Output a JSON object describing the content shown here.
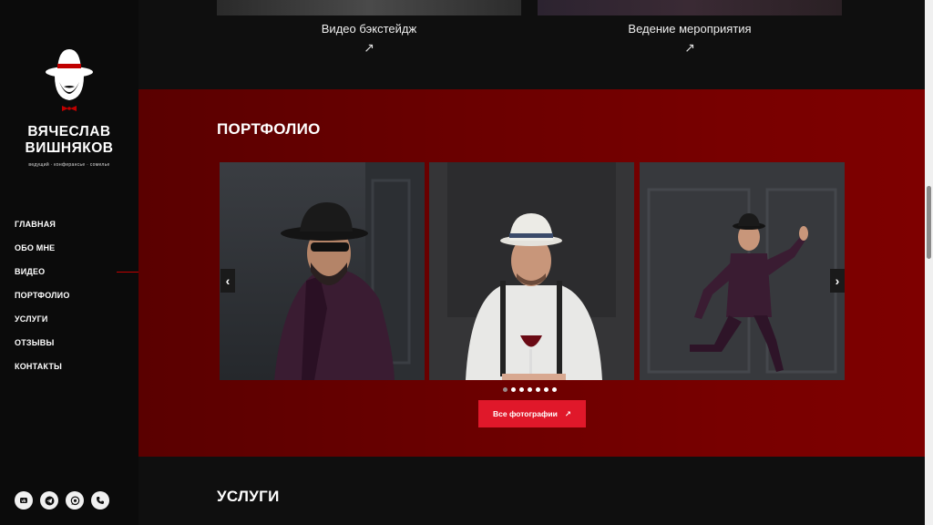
{
  "brand": {
    "name_line1": "ВЯЧЕСЛАВ",
    "name_line2": "ВИШНЯКОВ",
    "tagline": "ведущий · конферансье · сомелье"
  },
  "nav": {
    "items": [
      "ГЛАВНАЯ",
      "ОБО МНЕ",
      "ВИДЕО",
      "ПОРТФОЛИО",
      "УСЛУГИ",
      "ОТЗЫВЫ",
      "КОНТАКТЫ"
    ],
    "active_index": 2
  },
  "socials": [
    "vk-icon",
    "telegram-icon",
    "whatsapp-icon",
    "phone-icon"
  ],
  "video": {
    "items": [
      {
        "caption": "Видео бэкстейдж",
        "arrow": "↗"
      },
      {
        "caption": "Ведение мероприятия",
        "arrow": "↗"
      }
    ]
  },
  "portfolio": {
    "title": "ПОРТФОЛИО",
    "prev": "‹",
    "next": "›",
    "slide_count": 7,
    "active_dot": 0,
    "button_label": "Все фотографии",
    "button_arrow": "↗"
  },
  "services": {
    "title": "УСЛУГИ"
  },
  "colors": {
    "accent": "#e0182a",
    "portfolio_bg": "#7a0000",
    "sidebar_bg": "#0b0b0b",
    "page_bg": "#0f0f0f"
  }
}
